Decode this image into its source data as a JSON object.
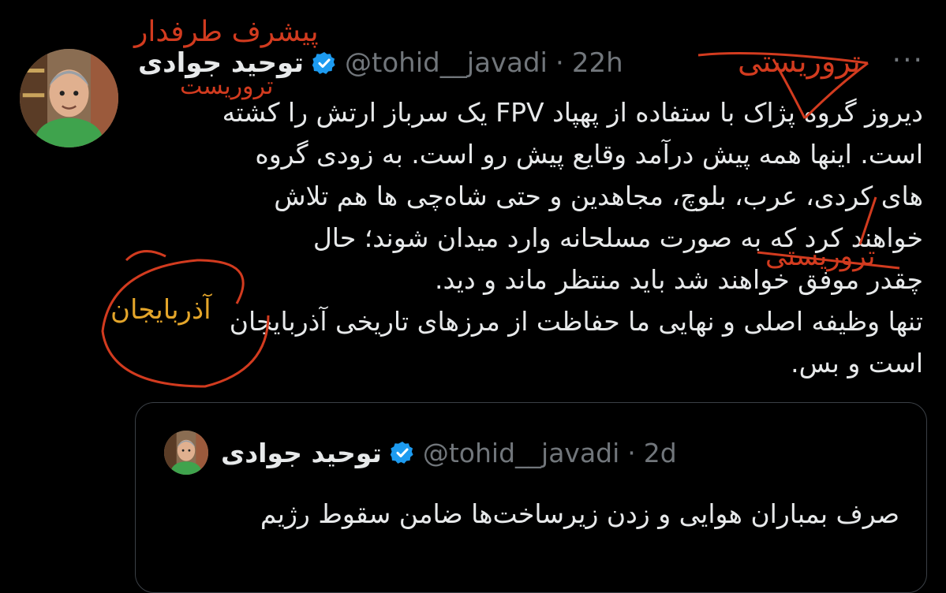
{
  "tweet": {
    "display_name": "توحید جوادی",
    "handle": "@tohid__javadi",
    "separator": "·",
    "time": "22h",
    "text_lines": [
      "دیروز گروه پژاک با ستفاده از پهپاد FPV یک سرباز ارتش را کشته",
      "است. اینها همه پیش درآمد وقایع پیش رو است. به زودی گروه",
      "های کردی، عرب، بلوچ، مجاهدین و حتی شاه‌چی ها هم تلاش",
      "خواهند کرد که به صورت مسلحانه وارد میدان شوند؛ حال",
      "چقدر موفق خواهند شد باید منتظر ماند و دید.",
      "تنها وظیفه اصلی و نهایی ما حفاظت از مرزهای تاریخی آذربایجان",
      "است و بس."
    ],
    "more_icon": "more-horizontal-icon",
    "verified_icon": "verified-badge-icon"
  },
  "quoted": {
    "display_name": "توحید جوادی",
    "handle": "@tohid__javadi",
    "separator": "·",
    "time": "2d",
    "text_lines": [
      "صرف بمباران هوایی و زدن زیرساخت‌ها ضامن سقوط رژیم"
    ]
  },
  "annotations": {
    "top_label_1": "پیشرف طرفدار",
    "top_label_2": "تروریست",
    "right_label_1": "تروریستی",
    "right_label_2": "تروریستی",
    "circled_label": "آذربایجان"
  },
  "colors": {
    "background": "#000000",
    "text": "#e7e9ea",
    "muted": "#71767b",
    "verified": "#1d9bf0",
    "annotation_red": "#d23b1f",
    "annotation_yellow": "#e3a52a"
  }
}
